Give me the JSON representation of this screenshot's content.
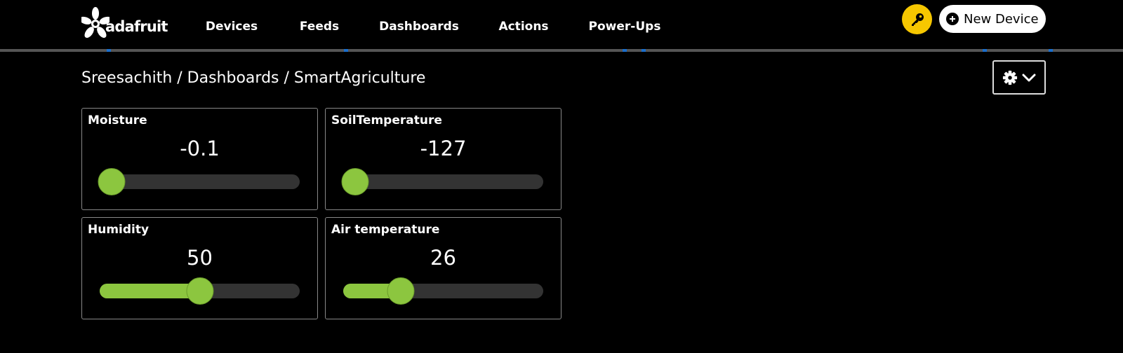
{
  "header": {
    "logo_text": "adafruit",
    "nav": [
      "Devices",
      "Feeds",
      "Dashboards",
      "Actions",
      "Power-Ups"
    ],
    "key_icon": "key-icon",
    "new_device_label": "New Device"
  },
  "breadcrumb": {
    "user": "Sreesachith",
    "separator": " / ",
    "section": "Dashboards",
    "dashboard": "SmartAgriculture"
  },
  "colors": {
    "accent_green": "#8cc63f",
    "key_yellow": "#f6c700",
    "divider_blue": "#1a6ecc"
  },
  "blocks": [
    {
      "title": "Moisture",
      "value": "-0.1",
      "slider_fraction": 0.0
    },
    {
      "title": "SoilTemperature",
      "value": "-127",
      "slider_fraction": 0.0
    },
    {
      "title": "Humidity",
      "value": "50",
      "slider_fraction": 0.5
    },
    {
      "title": "Air temperature",
      "value": "26",
      "slider_fraction": 0.26
    }
  ]
}
